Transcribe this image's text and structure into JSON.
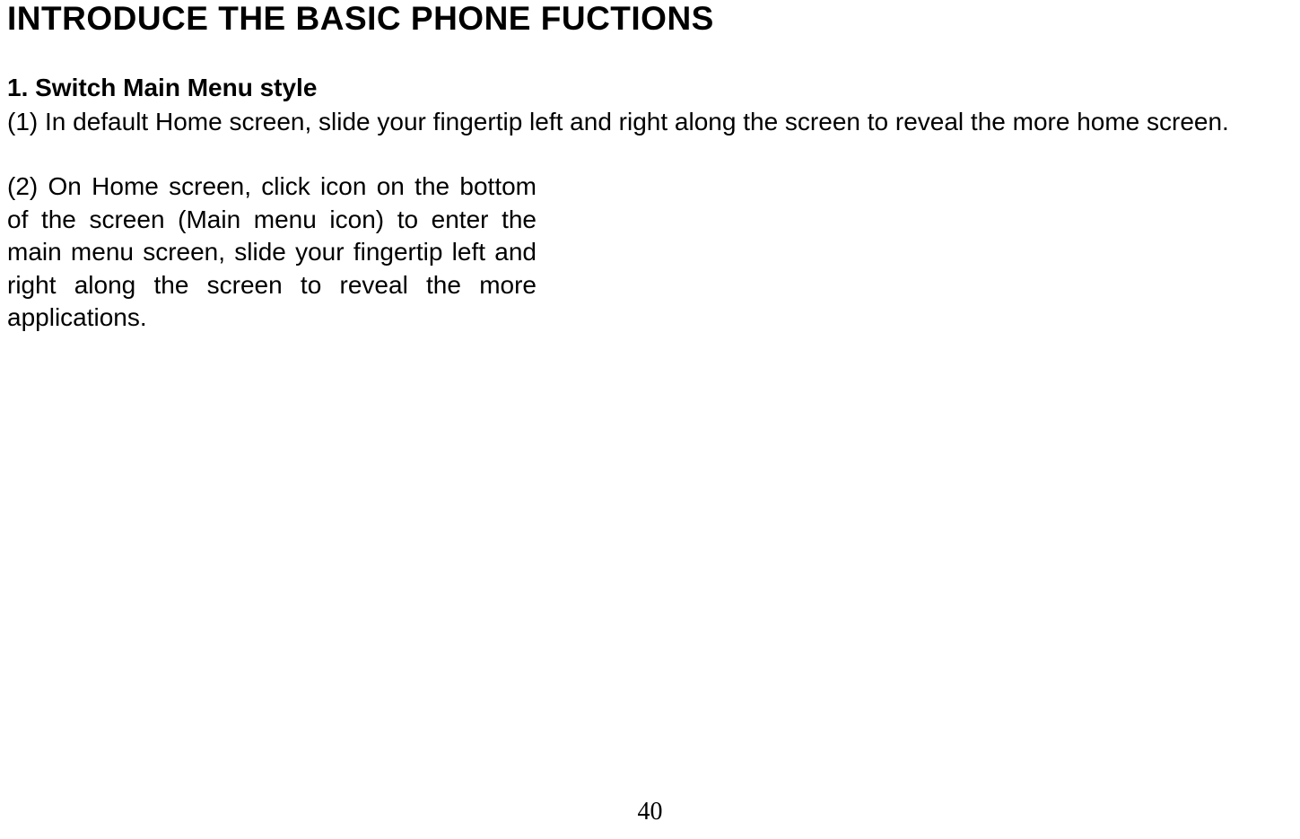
{
  "title": "INTRODUCE THE BASIC PHONE FUCTIONS",
  "section": {
    "heading": "1. Switch Main Menu style",
    "para1": "(1) In default Home screen, slide your fingertip left and right along the screen to reveal the more home screen.",
    "para2": "(2) On Home screen, click icon on the bottom of the screen (Main menu icon) to enter the main menu screen, slide your fingertip left and right along the screen to reveal the more applications."
  },
  "page_number": "40"
}
